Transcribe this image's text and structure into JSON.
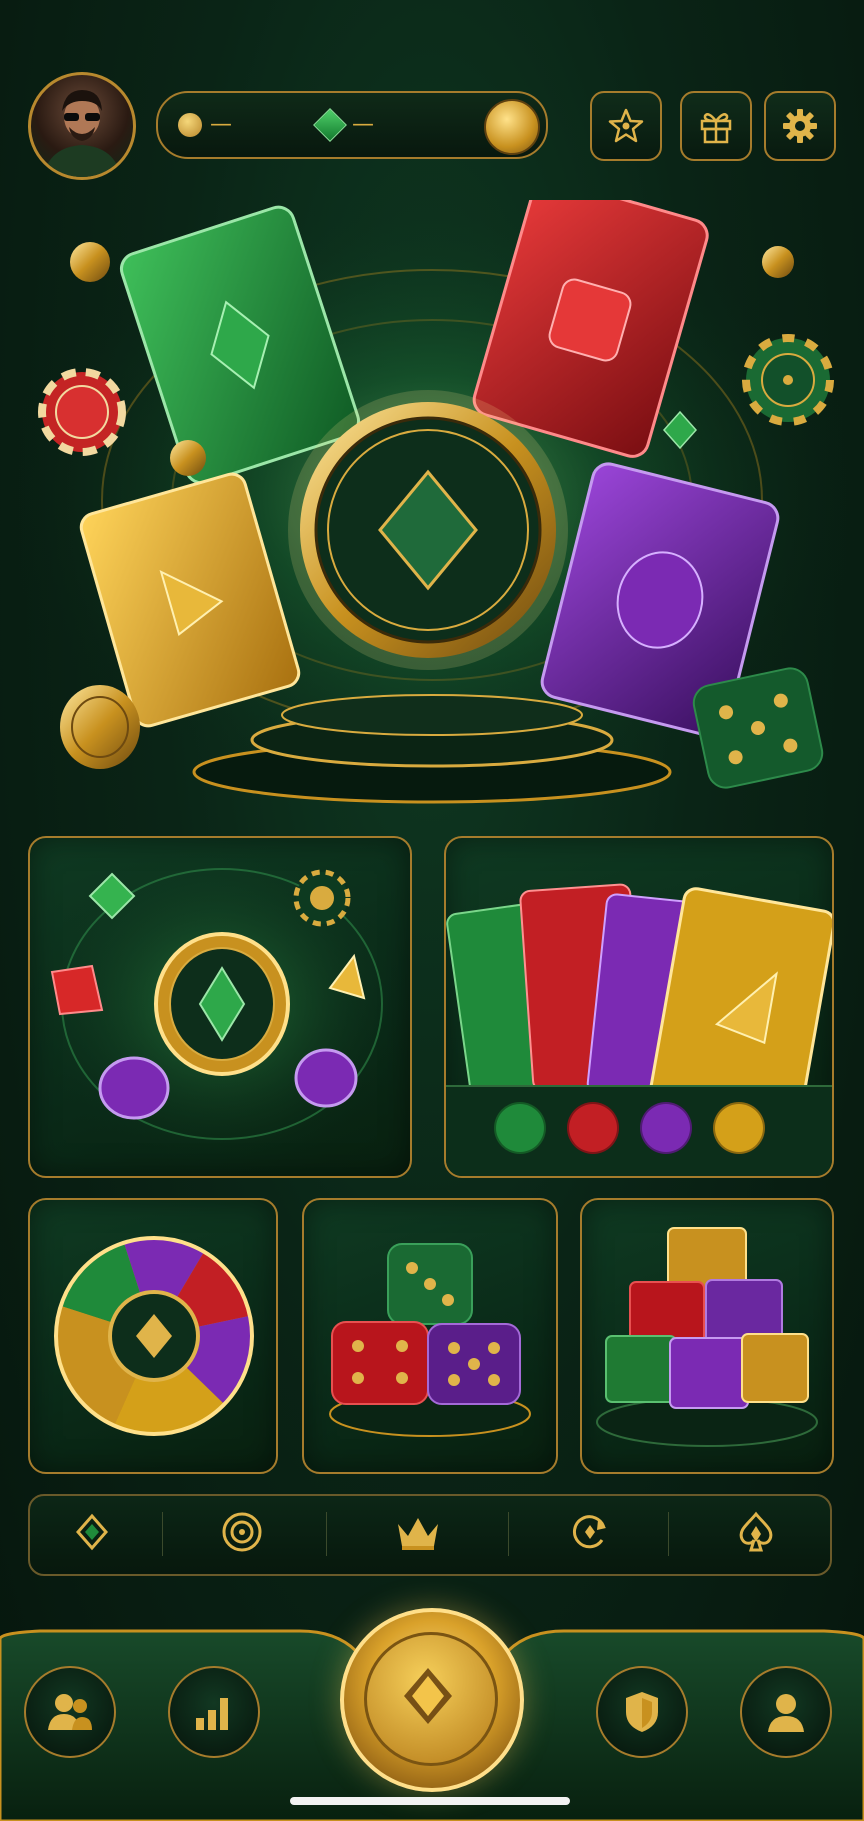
{
  "header": {
    "avatar": "player-avatar",
    "currency_bar": {
      "coin_value": "—",
      "gem_value": "—",
      "coin_icon": "gold-coin-icon",
      "gem_icon": "green-diamond-icon"
    },
    "buttons": [
      "star-icon",
      "gift-icon",
      "gear-icon"
    ]
  },
  "hero": {
    "center_icon": "diamond-icon",
    "cards": [
      "green-diamond-card",
      "red-square-card",
      "gold-triangle-card",
      "purple-circle-card"
    ]
  },
  "tiles": {
    "tile1": "gem-chips-game",
    "tile2": "card-colors-game",
    "tile2_colors": [
      "#1f8a3a",
      "#c21f24",
      "#7b2ab3",
      "#d4a019"
    ],
    "tile3": "color-wheel-game",
    "tile4": "dice-game",
    "tile5": "blocks-game"
  },
  "strip": [
    "diamond-icon",
    "target-icon",
    "crown-icon",
    "refresh-icon",
    "spade-icon"
  ],
  "bottom_nav": {
    "left": [
      "friends-icon",
      "stats-icon"
    ],
    "center": "play-diamond-icon",
    "right": [
      "shield-icon",
      "profile-icon"
    ]
  },
  "colors": {
    "gold": "#d9ab3f",
    "green": "#1f8a3a",
    "red": "#c21f24",
    "purple": "#7b2ab3",
    "bg": "#0a2416"
  }
}
